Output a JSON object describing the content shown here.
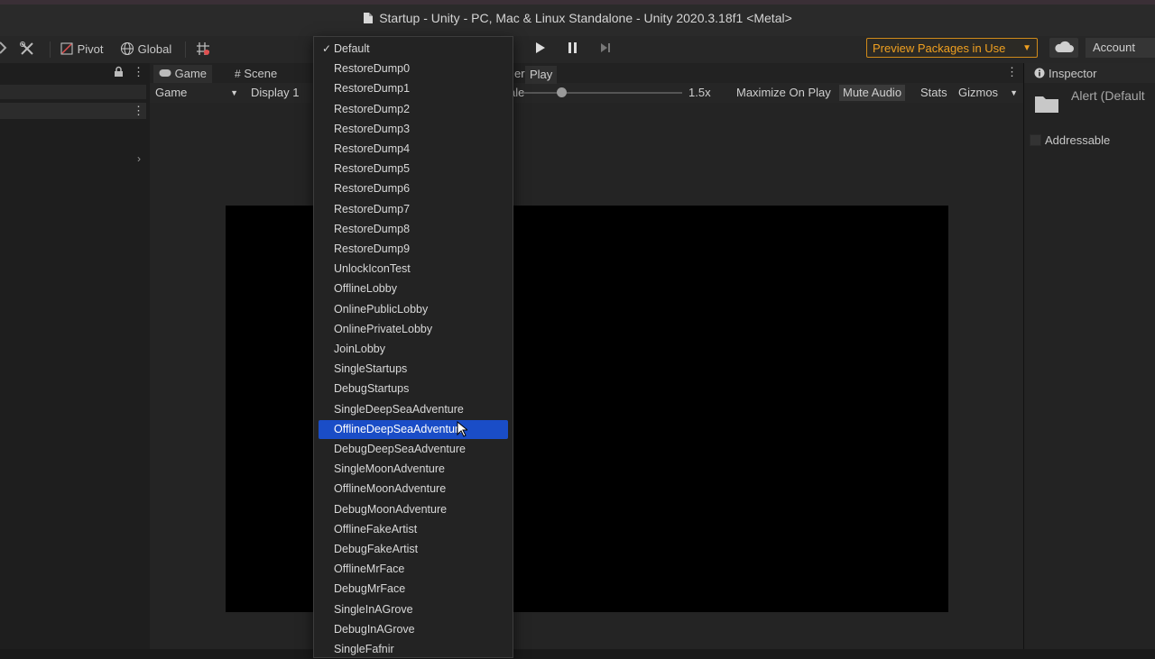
{
  "window": {
    "title": "Startup - Unity - PC, Mac & Linux Standalone - Unity 2020.3.18f1 <Metal>"
  },
  "toolbar": {
    "pivot": "Pivot",
    "global": "Global",
    "preview_packages": "Preview Packages in Use",
    "account": "Account"
  },
  "tabs": {
    "game": "Game",
    "scene": "Scene",
    "play_tooltip": "Play",
    "partial_tab": "er"
  },
  "gamebar": {
    "game_select": "Game",
    "display": "Display 1",
    "scale_label": "ale",
    "scale_value": "1.5x",
    "maximize": "Maximize On Play",
    "mute": "Mute Audio",
    "stats": "Stats",
    "gizmos": "Gizmos"
  },
  "inspector": {
    "title": "Inspector",
    "object_name": "Alert (Default",
    "addressable": "Addressable"
  },
  "dropdown": {
    "items": [
      {
        "label": "Default",
        "checked": true
      },
      {
        "label": "RestoreDump0"
      },
      {
        "label": "RestoreDump1"
      },
      {
        "label": "RestoreDump2"
      },
      {
        "label": "RestoreDump3"
      },
      {
        "label": "RestoreDump4"
      },
      {
        "label": "RestoreDump5"
      },
      {
        "label": "RestoreDump6"
      },
      {
        "label": "RestoreDump7"
      },
      {
        "label": "RestoreDump8"
      },
      {
        "label": "RestoreDump9"
      },
      {
        "label": "UnlockIconTest"
      },
      {
        "label": "OfflineLobby"
      },
      {
        "label": "OnlinePublicLobby"
      },
      {
        "label": "OnlinePrivateLobby"
      },
      {
        "label": "JoinLobby"
      },
      {
        "label": "SingleStartups"
      },
      {
        "label": "DebugStartups"
      },
      {
        "label": "SingleDeepSeaAdventure"
      },
      {
        "label": "OfflineDeepSeaAdventure",
        "selected": true
      },
      {
        "label": "DebugDeepSeaAdventure"
      },
      {
        "label": "SingleMoonAdventure"
      },
      {
        "label": "OfflineMoonAdventure"
      },
      {
        "label": "DebugMoonAdventure"
      },
      {
        "label": "OfflineFakeArtist"
      },
      {
        "label": "DebugFakeArtist"
      },
      {
        "label": "OfflineMrFace"
      },
      {
        "label": "DebugMrFace"
      },
      {
        "label": "SingleInAGrove"
      },
      {
        "label": "DebugInAGrove"
      },
      {
        "label": "SingleFafnir"
      }
    ]
  },
  "colors": {
    "accent": "#1a4dc7",
    "warning": "#f0a020"
  }
}
